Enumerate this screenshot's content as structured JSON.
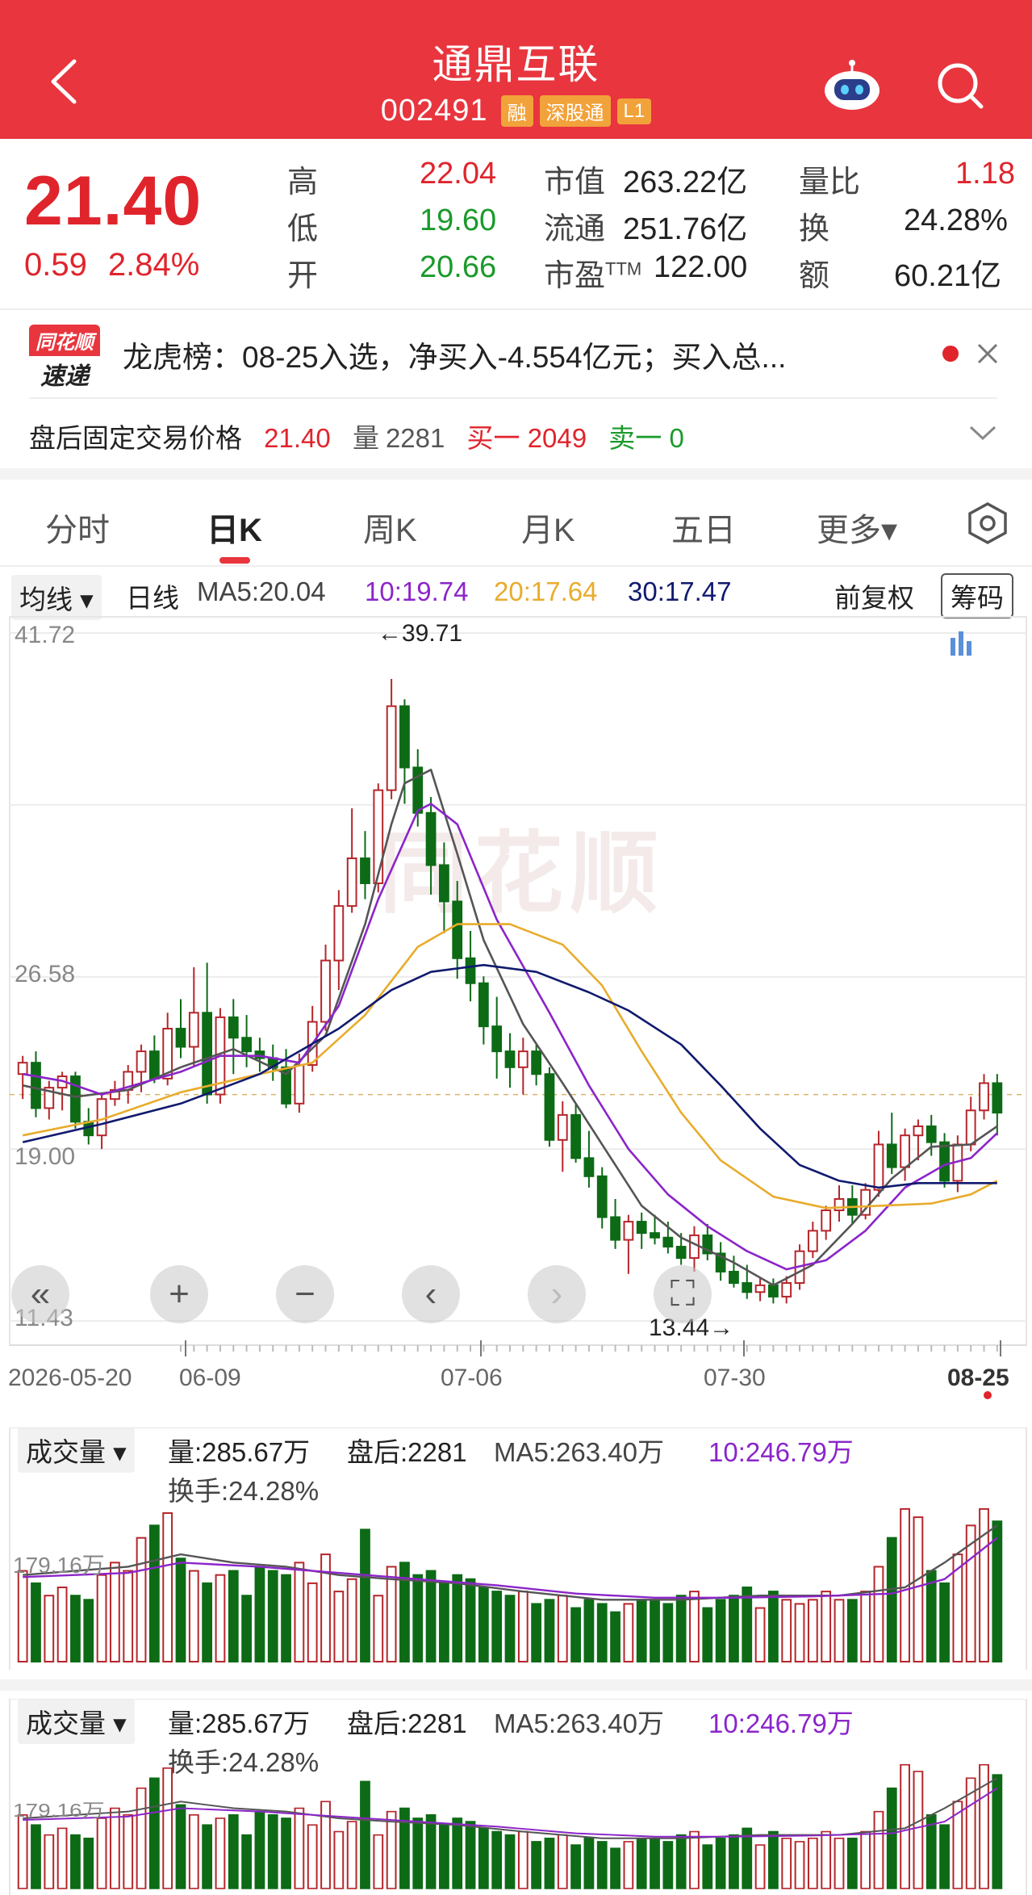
{
  "header": {
    "title": "通鼎互联",
    "code": "002491",
    "tags": [
      "融",
      "深股通",
      "L1"
    ]
  },
  "quote": {
    "price": "21.40",
    "change": "0.59",
    "change_pct": "2.84%",
    "high_label": "高",
    "high": "22.04",
    "low_label": "低",
    "low": "19.60",
    "open_label": "开",
    "open": "20.66",
    "mcap_label": "市值",
    "mcap": "263.22亿",
    "float_label": "流通",
    "float": "251.76亿",
    "pe_label": "市盈",
    "pe_sup": "TTM",
    "pe": "122.00",
    "vr_label": "量比",
    "vr": "1.18",
    "turn_label": "换",
    "turn": "24.28%",
    "amt_label": "额",
    "amt": "60.21亿"
  },
  "longhu": {
    "logo_top": "同花顺",
    "logo_bottom": "速递",
    "text": "龙虎榜：08-25入选，净买入-4.554亿元；买入总..."
  },
  "afterhours": {
    "label": "盘后固定交易价格",
    "price": "21.40",
    "vol_label": "量",
    "vol": "2281",
    "buy": "买一 2049",
    "sell": "卖一 0"
  },
  "tabs": [
    "分时",
    "日K",
    "周K",
    "月K",
    "五日",
    "更多▾"
  ],
  "ma": {
    "pill": "均线 ▾",
    "period": "日线",
    "ma5": "MA5:20.04",
    "ma10": "10:19.74",
    "ma20": "20:17.64",
    "ma30": "30:17.47",
    "adj": "前复权",
    "chip": "筹码"
  },
  "colors": {
    "up": "#b5262b",
    "down": "#0d6b16",
    "ma5": "#555555",
    "ma10": "#8b25c9",
    "ma20": "#e8ac2c",
    "ma30": "#101a6e",
    "header": "#e8353e"
  },
  "chart_data": {
    "type": "candlestick",
    "ylim": [
      11.43,
      41.72
    ],
    "y_ticks": [
      "41.72",
      "26.58",
      "19.00",
      "11.43"
    ],
    "x_ticks": [
      "2026-05-20",
      "06-09",
      "07-06",
      "07-30",
      "08-25"
    ],
    "max_label": "←39.71",
    "min_label": "13.44→",
    "ohlc": [
      [
        22.3,
        23.1,
        21.2,
        22.8
      ],
      [
        22.8,
        23.3,
        20.4,
        20.8
      ],
      [
        20.8,
        22.0,
        20.3,
        21.7
      ],
      [
        21.7,
        22.4,
        20.7,
        22.2
      ],
      [
        22.2,
        22.4,
        19.9,
        20.2
      ],
      [
        20.2,
        20.8,
        19.2,
        19.6
      ],
      [
        19.6,
        21.4,
        19.0,
        21.2
      ],
      [
        21.2,
        22.0,
        20.9,
        21.6
      ],
      [
        21.6,
        22.7,
        21.0,
        22.4
      ],
      [
        22.4,
        23.6,
        21.5,
        23.3
      ],
      [
        23.3,
        24.0,
        21.9,
        22.1
      ],
      [
        22.1,
        25.0,
        21.8,
        24.3
      ],
      [
        24.3,
        25.6,
        23.0,
        23.5
      ],
      [
        23.5,
        27.0,
        22.6,
        25.0
      ],
      [
        25.0,
        27.2,
        21.0,
        21.4
      ],
      [
        21.4,
        25.2,
        21.0,
        24.8
      ],
      [
        24.8,
        25.6,
        22.3,
        23.9
      ],
      [
        23.9,
        24.9,
        22.6,
        23.3
      ],
      [
        23.3,
        23.9,
        22.4,
        23.0
      ],
      [
        23.0,
        23.6,
        22.0,
        22.6
      ],
      [
        22.6,
        23.4,
        20.8,
        21.0
      ],
      [
        21.0,
        23.2,
        20.6,
        22.7
      ],
      [
        22.7,
        25.3,
        22.4,
        24.6
      ],
      [
        24.6,
        28.0,
        24.2,
        27.3
      ],
      [
        27.3,
        30.4,
        26.0,
        29.7
      ],
      [
        29.7,
        34.0,
        29.4,
        31.8
      ],
      [
        31.8,
        33.0,
        30.0,
        30.7
      ],
      [
        30.7,
        35.1,
        30.3,
        34.8
      ],
      [
        34.8,
        39.7,
        34.4,
        38.5
      ],
      [
        38.5,
        38.8,
        34.2,
        35.8
      ],
      [
        35.8,
        36.6,
        33.2,
        33.8
      ],
      [
        33.8,
        34.5,
        30.2,
        31.5
      ],
      [
        31.5,
        32.5,
        28.5,
        29.9
      ],
      [
        29.9,
        30.8,
        26.5,
        27.4
      ],
      [
        27.4,
        28.6,
        25.5,
        26.3
      ],
      [
        26.3,
        26.6,
        23.6,
        24.4
      ],
      [
        24.4,
        25.7,
        22.1,
        23.3
      ],
      [
        23.3,
        24.1,
        21.7,
        22.6
      ],
      [
        22.6,
        23.9,
        21.4,
        23.3
      ],
      [
        23.3,
        23.6,
        21.8,
        22.3
      ],
      [
        22.3,
        22.6,
        19.1,
        19.4
      ],
      [
        19.4,
        21.1,
        18.0,
        20.5
      ],
      [
        20.5,
        21.0,
        18.4,
        18.6
      ],
      [
        18.6,
        19.8,
        17.3,
        17.8
      ],
      [
        17.8,
        18.2,
        15.5,
        16.0
      ],
      [
        16.0,
        16.8,
        14.6,
        15.0
      ],
      [
        15.0,
        16.1,
        13.5,
        15.8
      ],
      [
        15.8,
        16.2,
        14.6,
        15.3
      ],
      [
        15.3,
        16.1,
        14.8,
        15.1
      ],
      [
        15.1,
        15.8,
        14.4,
        14.7
      ],
      [
        14.7,
        15.3,
        13.9,
        14.2
      ],
      [
        14.2,
        15.6,
        13.6,
        15.2
      ],
      [
        15.2,
        15.7,
        14.1,
        14.4
      ],
      [
        14.4,
        14.9,
        13.2,
        13.6
      ],
      [
        13.6,
        14.3,
        12.9,
        13.1
      ],
      [
        13.1,
        13.9,
        12.4,
        12.7
      ],
      [
        12.7,
        13.3,
        12.3,
        13.0
      ],
      [
        13.0,
        13.3,
        12.2,
        12.5
      ],
      [
        12.5,
        13.4,
        12.2,
        13.1
      ],
      [
        13.1,
        14.8,
        12.8,
        14.5
      ],
      [
        14.5,
        15.8,
        14.2,
        15.4
      ],
      [
        15.4,
        16.5,
        15.0,
        16.3
      ],
      [
        16.3,
        17.4,
        15.8,
        16.8
      ],
      [
        16.8,
        17.4,
        15.7,
        16.1
      ],
      [
        16.1,
        17.5,
        15.9,
        17.2
      ],
      [
        17.2,
        19.8,
        16.9,
        19.2
      ],
      [
        19.2,
        20.6,
        17.9,
        18.2
      ],
      [
        18.2,
        19.9,
        17.6,
        19.6
      ],
      [
        19.6,
        20.3,
        18.5,
        20.0
      ],
      [
        20.0,
        20.5,
        18.7,
        19.3
      ],
      [
        19.3,
        19.7,
        17.3,
        17.6
      ],
      [
        17.6,
        19.6,
        17.1,
        19.2
      ],
      [
        19.2,
        21.3,
        18.9,
        20.7
      ],
      [
        20.7,
        22.3,
        20.3,
        21.9
      ],
      [
        21.9,
        22.3,
        19.6,
        20.6
      ]
    ],
    "ma": {
      "ma5": [
        [
          0,
          21.8
        ],
        [
          4,
          21.3
        ],
        [
          8,
          21.6
        ],
        [
          12,
          22.6
        ],
        [
          16,
          23.4
        ],
        [
          20,
          22.3
        ],
        [
          23,
          24.0
        ],
        [
          26,
          28.9
        ],
        [
          28,
          33.3
        ],
        [
          29,
          35.1
        ],
        [
          31,
          35.7
        ],
        [
          33,
          32.0
        ],
        [
          35,
          28.2
        ],
        [
          38,
          24.5
        ],
        [
          41,
          21.9
        ],
        [
          44,
          19.2
        ],
        [
          47,
          16.5
        ],
        [
          50,
          15.1
        ],
        [
          54,
          14.0
        ],
        [
          57,
          13.0
        ],
        [
          60,
          13.9
        ],
        [
          63,
          15.7
        ],
        [
          66,
          17.7
        ],
        [
          69,
          19.1
        ],
        [
          72,
          19.2
        ],
        [
          74,
          20.0
        ]
      ],
      "ma10": [
        [
          0,
          22.3
        ],
        [
          3,
          22.0
        ],
        [
          6,
          21.4
        ],
        [
          9,
          21.9
        ],
        [
          12,
          22.4
        ],
        [
          15,
          23.1
        ],
        [
          18,
          23.1
        ],
        [
          21,
          22.8
        ],
        [
          24,
          25.3
        ],
        [
          27,
          30.0
        ],
        [
          30,
          33.9
        ],
        [
          31,
          34.2
        ],
        [
          33,
          33.3
        ],
        [
          36,
          29.1
        ],
        [
          40,
          25.0
        ],
        [
          43,
          21.8
        ],
        [
          46,
          19.0
        ],
        [
          49,
          17.0
        ],
        [
          52,
          15.6
        ],
        [
          55,
          14.5
        ],
        [
          58,
          13.7
        ],
        [
          61,
          14.1
        ],
        [
          64,
          15.4
        ],
        [
          67,
          17.3
        ],
        [
          70,
          18.3
        ],
        [
          72,
          18.6
        ],
        [
          74,
          19.7
        ]
      ],
      "ma20": [
        [
          0,
          19.6
        ],
        [
          6,
          20.3
        ],
        [
          12,
          21.5
        ],
        [
          18,
          22.3
        ],
        [
          22,
          22.8
        ],
        [
          26,
          24.9
        ],
        [
          30,
          27.9
        ],
        [
          33,
          28.9
        ],
        [
          37,
          28.9
        ],
        [
          41,
          28.0
        ],
        [
          44,
          26.2
        ],
        [
          47,
          23.3
        ],
        [
          50,
          20.6
        ],
        [
          53,
          18.5
        ],
        [
          57,
          16.9
        ],
        [
          61,
          16.4
        ],
        [
          65,
          16.5
        ],
        [
          69,
          16.6
        ],
        [
          72,
          17.0
        ],
        [
          74,
          17.6
        ]
      ],
      "ma30": [
        [
          0,
          19.3
        ],
        [
          6,
          20.1
        ],
        [
          12,
          21.0
        ],
        [
          18,
          22.3
        ],
        [
          24,
          24.3
        ],
        [
          28,
          26.0
        ],
        [
          31,
          26.8
        ],
        [
          35,
          27.1
        ],
        [
          39,
          26.8
        ],
        [
          43,
          25.9
        ],
        [
          46,
          25.1
        ],
        [
          50,
          23.6
        ],
        [
          53,
          21.8
        ],
        [
          56,
          19.9
        ],
        [
          59,
          18.3
        ],
        [
          62,
          17.6
        ],
        [
          65,
          17.3
        ],
        [
          68,
          17.5
        ],
        [
          71,
          17.5
        ],
        [
          74,
          17.5
        ]
      ]
    }
  },
  "volume_panel": {
    "pill": "成交量 ▾",
    "vol": "量:285.67万",
    "after": "盘后:2281",
    "ma5": "MA5:263.40万",
    "ma10": "10:246.79万",
    "turnover": "换手:24.28%",
    "level_label": "179.16万",
    "ylim": [
      0,
      450
    ],
    "bars": [
      220,
      190,
      160,
      180,
      160,
      150,
      210,
      240,
      220,
      300,
      330,
      360,
      250,
      220,
      190,
      210,
      220,
      160,
      230,
      220,
      210,
      240,
      190,
      260,
      170,
      200,
      320,
      160,
      230,
      240,
      210,
      220,
      190,
      210,
      200,
      180,
      170,
      160,
      170,
      140,
      150,
      160,
      130,
      150,
      140,
      120,
      140,
      150,
      150,
      140,
      160,
      170,
      130,
      150,
      160,
      180,
      130,
      170,
      150,
      140,
      150,
      170,
      150,
      150,
      170,
      230,
      300,
      370,
      350,
      220,
      190,
      260,
      330,
      370,
      340
    ],
    "ma5_line": [
      [
        0,
        210
      ],
      [
        8,
        230
      ],
      [
        12,
        260
      ],
      [
        16,
        240
      ],
      [
        20,
        230
      ],
      [
        24,
        210
      ],
      [
        28,
        200
      ],
      [
        33,
        190
      ],
      [
        38,
        170
      ],
      [
        44,
        150
      ],
      [
        50,
        150
      ],
      [
        56,
        160
      ],
      [
        62,
        160
      ],
      [
        67,
        180
      ],
      [
        70,
        240
      ],
      [
        74,
        330
      ]
    ],
    "ma10_line": [
      [
        0,
        205
      ],
      [
        8,
        215
      ],
      [
        12,
        240
      ],
      [
        18,
        230
      ],
      [
        24,
        215
      ],
      [
        30,
        200
      ],
      [
        36,
        185
      ],
      [
        42,
        165
      ],
      [
        48,
        155
      ],
      [
        54,
        155
      ],
      [
        60,
        158
      ],
      [
        66,
        165
      ],
      [
        70,
        200
      ],
      [
        74,
        300
      ]
    ]
  },
  "volume_panel2": {
    "pill": "成交量 ▾",
    "vol": "量:285.67万",
    "after": "盘后:2281",
    "ma5": "MA5:263.40万",
    "ma10": "10:246.79万",
    "turnover": "换手:24.28%",
    "level_label": "179.16万"
  }
}
